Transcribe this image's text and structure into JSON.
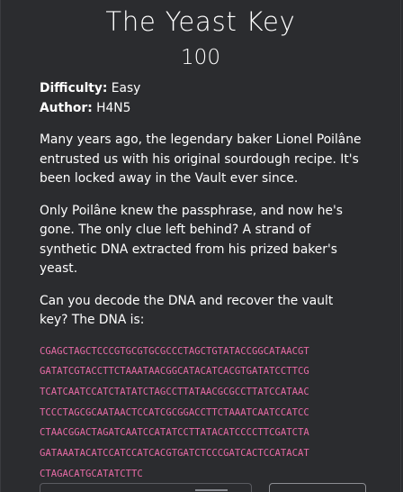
{
  "challenge": {
    "title": "The Yeast Key",
    "points": "100",
    "difficulty_label": "Difficulty:",
    "difficulty_value": "Easy",
    "author_label": "Author:",
    "author_value": "H4N5",
    "paragraphs": [
      "Many years ago, the legendary baker Lionel Poilâne entrusted us with his original sourdough recipe. It's been locked away in the Vault ever since.",
      "Only Poilâne knew the passphrase, and now he's gone. The only clue left behind? A strand of synthetic DNA extracted from his prized baker's yeast.",
      "Can you decode the DNA and recover the vault key? The DNA is:"
    ],
    "dna_lines": [
      "CGAGCTAGCTCCCGTGCGTGCGCCCTAGCTGTATACCGGCATAACGT",
      "GATATCGTACCTTCTAAATAACGGCATACATCACGTGATATCCTTCG",
      "TCATCAATCCATCTATATCTAGCCTTATAACGCGCCTTATCCATAAC",
      "TCCCTAGCGCAATAACTCCATCGCGGACCTTCTAAATCAATCCATCC",
      "CTAACGGACTAGATCAATCCATATCCTTATACATCCCCTTCGATCTA",
      "GATAAATACATCCATCCATCACGTGATCTCCCGATCACTCCATACAT",
      "CTAGACATGCATATCTTC"
    ]
  },
  "colors": {
    "background": "#2b2c2f",
    "text": "#ffffff",
    "dna_text": "#e86ba6"
  }
}
